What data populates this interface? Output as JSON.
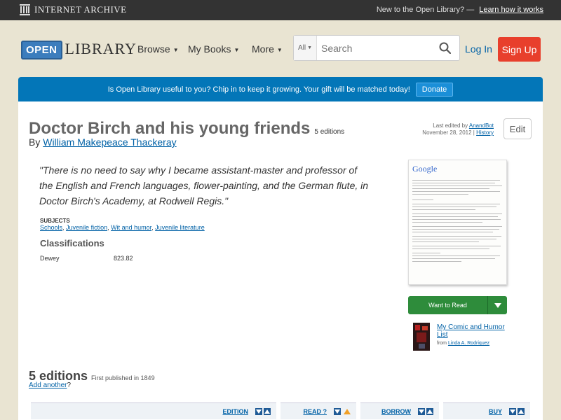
{
  "ia_bar": {
    "logo_text": "INTERNET ARCHIVE",
    "new_text": "New to the Open Library? —",
    "learn_link": "Learn how it works"
  },
  "header": {
    "logo_open": "OPEN",
    "logo_library": "LIBRARY",
    "nav": [
      "Browse",
      "My Books",
      "More"
    ],
    "search_scope": "All",
    "search_placeholder": "Search",
    "login": "Log In",
    "signup": "Sign Up"
  },
  "donate": {
    "text": "Is Open Library useful to you? Chip in to keep it growing. Your gift will be matched today!",
    "button": "Donate"
  },
  "book": {
    "title": "Doctor Birch and his young friends",
    "editions_badge": "5 editions",
    "by": "By",
    "author": "William Makepeace Thackeray",
    "last_edited_label": "Last edited by",
    "last_edited_user": "AnandBot",
    "last_edited_date": "November 28, 2012 |",
    "history": "History",
    "edit_button": "Edit",
    "quote": "\"There is no need to say why I became assistant-master and professor of the English and French languages, flower-painting, and the German flute, in Doctor Birch's Academy, at Rodwell Regis.\"",
    "subjects_heading": "SUBJECTS",
    "subjects": [
      "Schools",
      "Juvenile fiction",
      "Wit and humor",
      "Juvenile literature"
    ],
    "classifications_heading": "Classifications",
    "dewey_label": "Dewey",
    "dewey_value": "823.82",
    "cover_google": "Google",
    "want_to_read": "Want to Read",
    "list_title": "My Comic and Humor List",
    "list_from": "from",
    "list_owner": "Linda A. Rodriquez"
  },
  "editions": {
    "heading": "5 editions",
    "first_published": "First published in 1849",
    "add_another": "Add another",
    "add_suffix": "?",
    "columns": [
      "EDITION",
      "READ",
      "BORROW",
      "BUY"
    ]
  },
  "colors": {
    "signup": "#e83f2c",
    "donate_bar": "#0376b8",
    "want_to_read": "#2e8c3b",
    "link": "#0061a6"
  }
}
